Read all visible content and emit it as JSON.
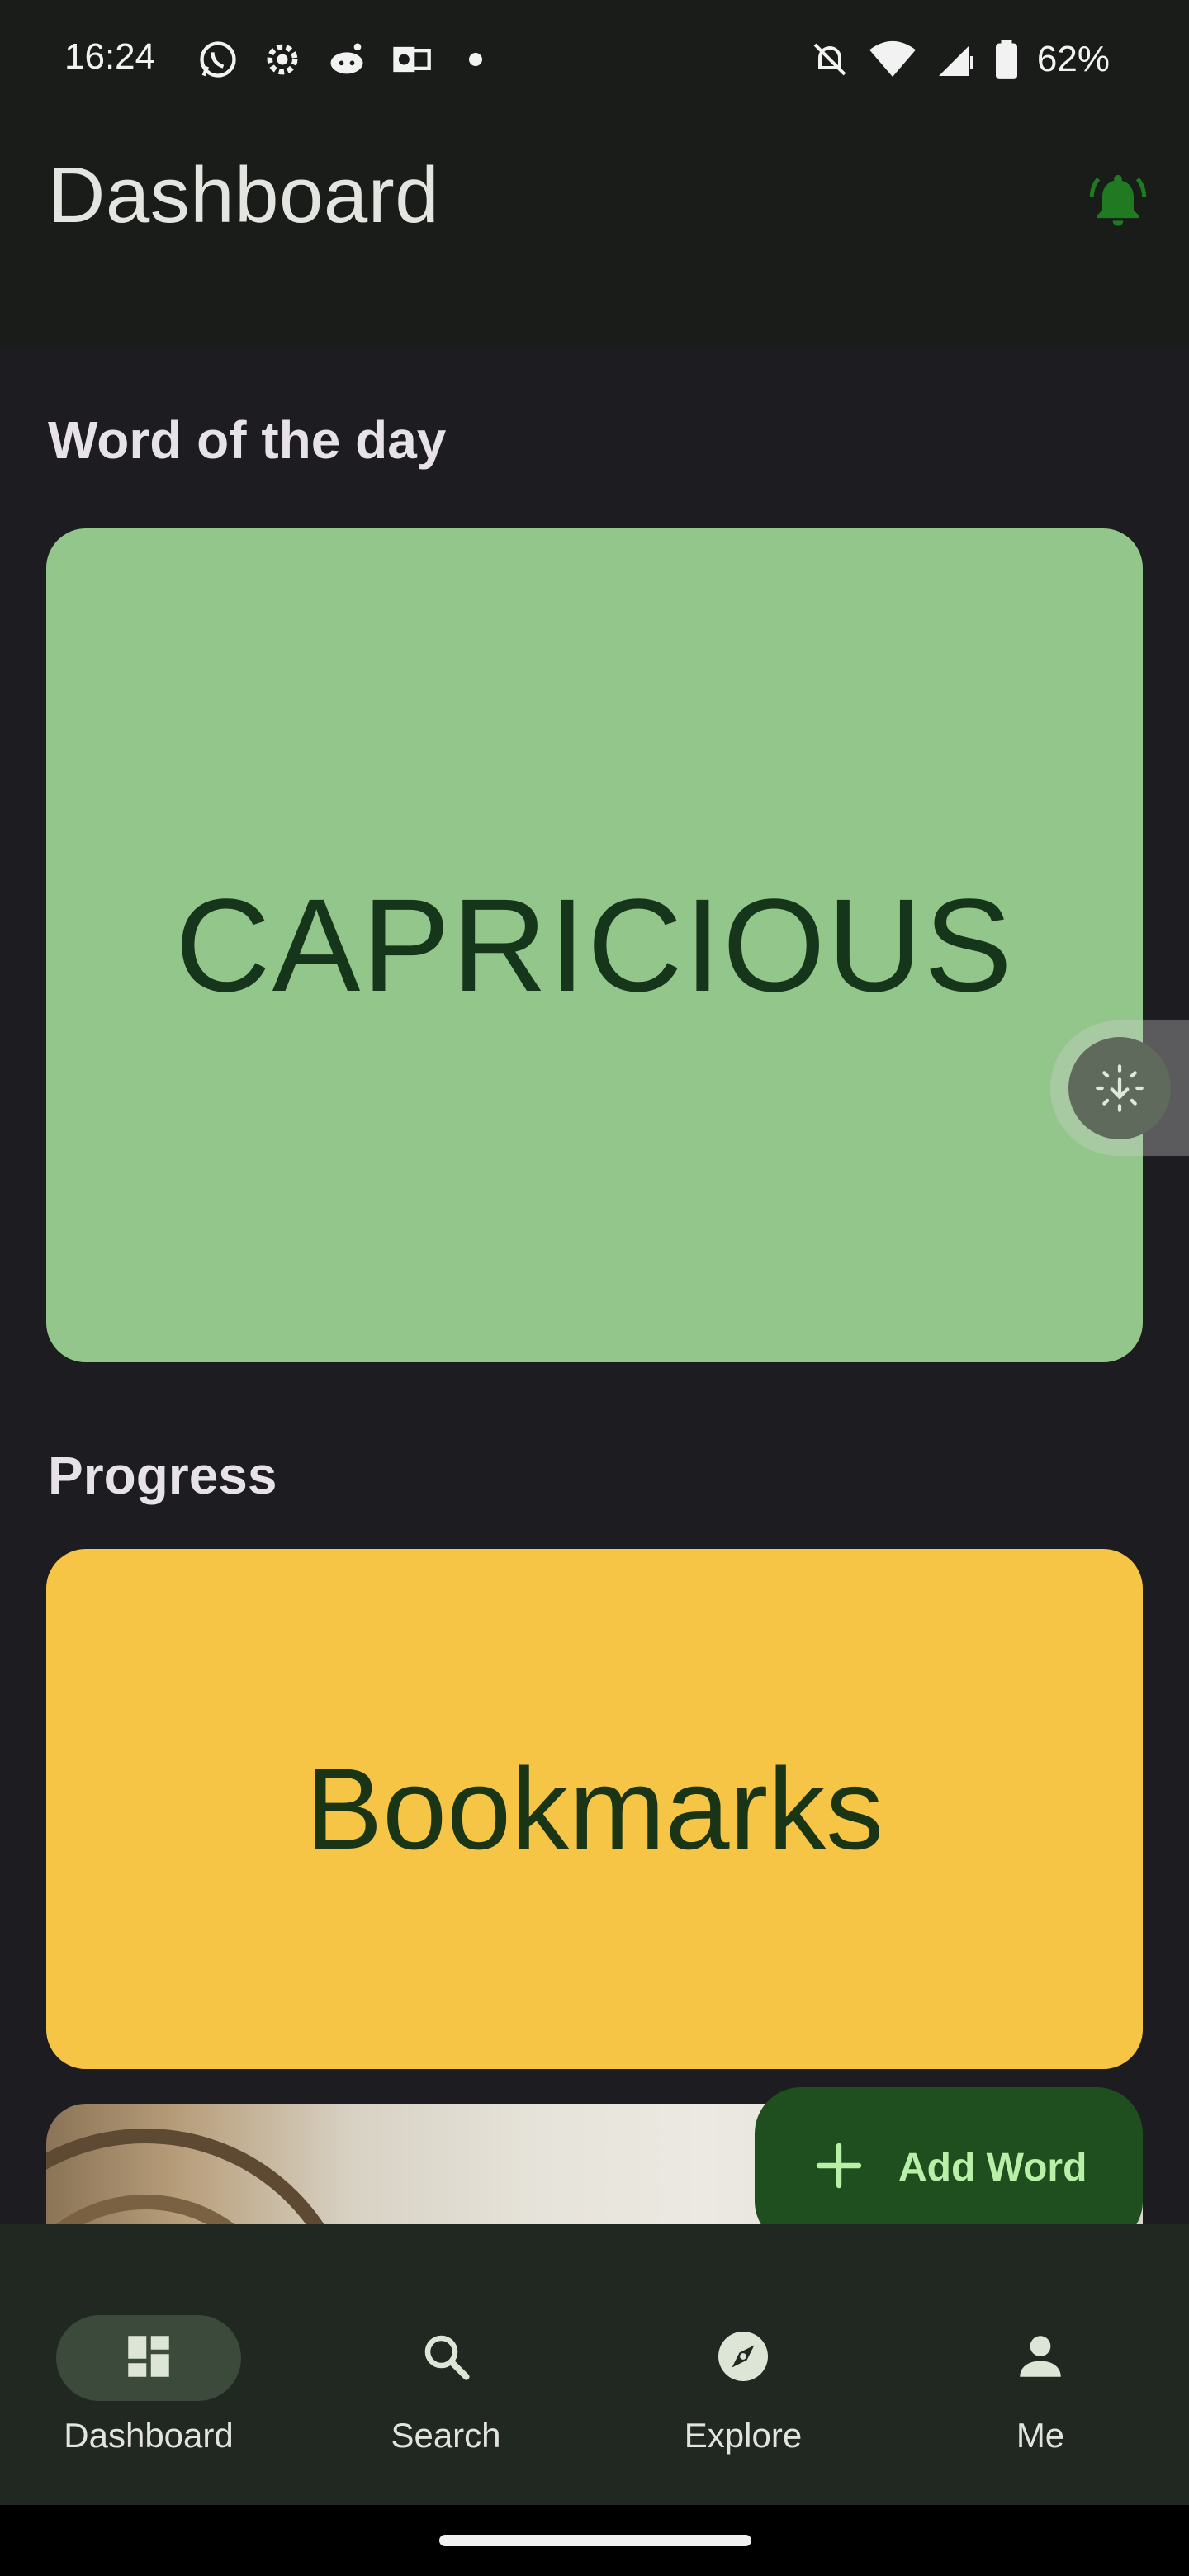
{
  "status_bar": {
    "time": "16:24",
    "left_icons": [
      "whatsapp-icon",
      "settings-gear-icon",
      "reddit-icon",
      "outlook-icon",
      "dot-icon"
    ],
    "right_icons": [
      "bell-off-icon",
      "wifi-icon",
      "cell-signal-icon",
      "battery-icon"
    ],
    "battery": "62%"
  },
  "app_bar": {
    "title": "Dashboard",
    "action_icon": "notification-bell-icon"
  },
  "word_of_the_day": {
    "heading": "Word of the day",
    "word": "CAPRICIOUS"
  },
  "progress": {
    "heading": "Progress",
    "card_label": "Bookmarks"
  },
  "fab": {
    "label": "Add Word",
    "icon": "plus-icon"
  },
  "bottom_nav": {
    "items": [
      {
        "label": "Dashboard",
        "icon": "dashboard-icon",
        "active": true
      },
      {
        "label": "Search",
        "icon": "search-icon",
        "active": false
      },
      {
        "label": "Explore",
        "icon": "compass-icon",
        "active": false
      },
      {
        "label": "Me",
        "icon": "person-icon",
        "active": false
      }
    ]
  },
  "colors": {
    "wotd_card": "#92c68a",
    "progress_card": "#f6c545",
    "fab": "#1f4f1f",
    "accent_text": "#15361a"
  }
}
